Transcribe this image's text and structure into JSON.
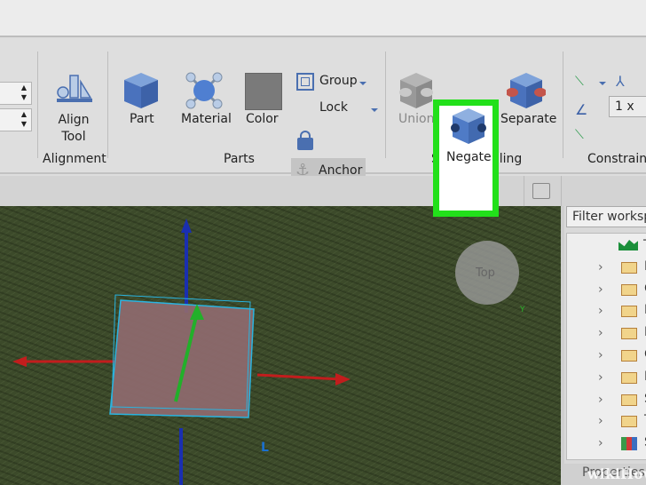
{
  "ribbon": {
    "align_tool": "Align\nTool",
    "alignment_group": "Alignment",
    "part": "Part",
    "material": "Material",
    "color": "Color",
    "group": "Group",
    "lock": "Lock",
    "anchor": "Anchor",
    "parts_group": "Parts",
    "union": "Union",
    "negate": "Negate",
    "separate": "Separate",
    "solid_modeling_group": "Solid Modeling",
    "scale_value": "1 x",
    "constraints_group": "Constraints",
    "highlight_color": "#22e01a"
  },
  "viewport": {
    "view_cube_label": "Top",
    "axis_y_label": "Y",
    "axis_l_label": "L"
  },
  "explorer": {
    "filter_placeholder": "Filter workspace",
    "items": [
      "T",
      "I",
      "C",
      "I",
      "I",
      "C",
      "I",
      "S",
      "T",
      "S"
    ],
    "properties_tab": "Properties"
  },
  "watermark": "wikiHow"
}
